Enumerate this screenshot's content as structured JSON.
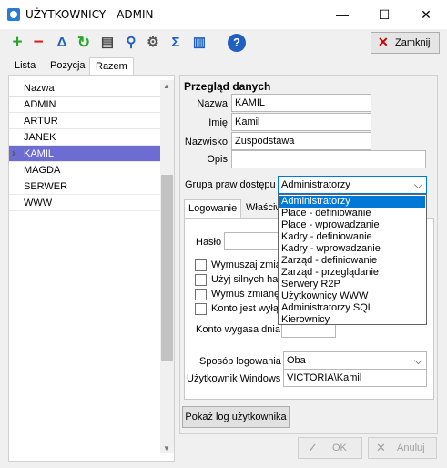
{
  "window": {
    "title": "UŻYTKOWNICY - ADMIN",
    "minimize": "—",
    "maximize": "☐",
    "close": "✕"
  },
  "toolbar": {
    "close_button": "Zamknij",
    "icons": [
      "plus-icon",
      "minus-icon",
      "filter-icon",
      "refresh-icon",
      "print-icon",
      "search-icon",
      "settings-icon",
      "sigma-icon",
      "columns-icon",
      "help-icon"
    ]
  },
  "tabs": [
    "Lista",
    "Pozycja",
    "Razem"
  ],
  "list": {
    "header": "Nazwa",
    "rows": [
      "ADMIN",
      "ARTUR",
      "JANEK",
      "KAMIL",
      "MAGDA",
      "SERWER",
      "WWW"
    ],
    "selected": "KAMIL"
  },
  "details": {
    "section_title": "Przegląd danych",
    "name_label": "Nazwa",
    "name_value": "KAMIL",
    "first_name_label": "Imię",
    "first_name_value": "Kamil",
    "last_name_label": "Nazwisko",
    "last_name_value": "Zuspodstawa",
    "description_label": "Opis",
    "description_value": "",
    "group_label": "Grupa praw dostępu",
    "group_value": "Administratorzy"
  },
  "subtabs": [
    "Logowanie",
    "Właściw"
  ],
  "login": {
    "password_label": "Hasło",
    "checkboxes": [
      "Wymuszaj zmia",
      "Użyj silnych has",
      "Wymuś zmianę",
      "Konto jest wyłą"
    ],
    "expires_label": "Konto wygasa dnia",
    "login_method_label": "Sposób logowania",
    "login_method_value": "Oba",
    "windows_user_label": "Użytkownik Windows",
    "windows_user_value": "VICTORIA\\Kamil"
  },
  "dropdown_options": [
    "Administratorzy",
    "Płace - definiowanie",
    "Płace - wprowadzanie",
    "Kadry - definiowanie",
    "Kadry - wprowadzanie",
    "Zarząd - definiowanie",
    "Zarząd - przeglądanie",
    "Serwery R2P",
    "Użytkownicy WWW",
    "Administratorzy SQL",
    "Kierownicy"
  ],
  "buttons": {
    "show_log": "Pokaż log użytkownika",
    "ok": "OK",
    "cancel": "Anuluj"
  },
  "colors": {
    "selection_row": "#6c6cd2",
    "dropdown_highlight": "#0078d7",
    "add_green": "#2aa52a",
    "remove_red": "#d22",
    "help_blue": "#1f5fbf"
  }
}
